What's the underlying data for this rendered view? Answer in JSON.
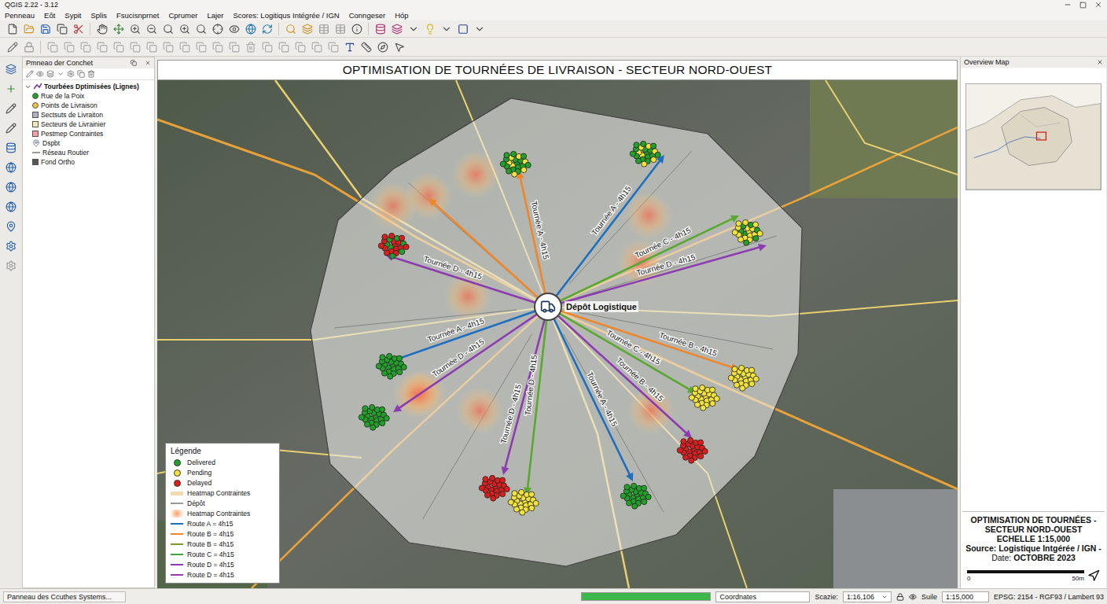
{
  "window": {
    "title": "QGIS 2.22 - 3.12"
  },
  "menu": [
    "Penneau",
    "Eôt",
    "Sypit",
    "Splis",
    "Fsucisnprnet",
    "Cprumer",
    "Lajer",
    "Scores: Logitiqus Intégrée / IGN",
    "Conngeser",
    "Hóp"
  ],
  "layers_panel": {
    "title": "Pmneao der Conchet",
    "layers": [
      {
        "label": "Tourbées Dptimisées (Lignes)",
        "kind": "group",
        "expanded": true,
        "color": "#6b3fa0"
      },
      {
        "label": "Rue de la Poix",
        "kind": "point",
        "color": "#22a02a"
      },
      {
        "label": "Points de Livraison",
        "kind": "point",
        "color": "#f2c43a"
      },
      {
        "label": "Sectsuts de Livraiton",
        "kind": "polygon",
        "color": "#a9b4c0"
      },
      {
        "label": "Secteurs de Livrainier",
        "kind": "polygon",
        "color": "#f3ecb0"
      },
      {
        "label": "Pestmep Contraintes",
        "kind": "heat",
        "color": "#f4a0a0"
      },
      {
        "label": "Dspbt",
        "kind": "pin",
        "color": "#5a6a80"
      },
      {
        "label": "Réseau Routier",
        "kind": "line",
        "color": "#9a9a9a"
      },
      {
        "label": "Fond Ortho",
        "kind": "raster",
        "color": "#555555"
      }
    ]
  },
  "map": {
    "title": "OPTIMISATION DE TOURNÉES DE LIVRAISON - SECTEUR NORD-OUEST",
    "depot": "Dépôt Logistique",
    "routes": [
      {
        "color": "#f0862a"
      },
      {
        "label": "Tournée A - 4h15",
        "color": "#f0862a"
      },
      {
        "label": "Tournée A - 4h15",
        "color": "#1f6fc0"
      },
      {
        "label": "Tournée C - 4h15",
        "color": "#5aa832"
      },
      {
        "label": "Tournée D - 4h15",
        "color": "#8c3cb0"
      },
      {
        "label": "Tournée D - 4h15",
        "color": "#8c3cb0"
      },
      {
        "label": "Tournée A - 4h15",
        "color": "#1f6fc0"
      },
      {
        "label": "Tournée D - 4h15",
        "color": "#8c3cb0"
      },
      {
        "label": "Tournée D - 4h15",
        "color": "#8c3cb0"
      },
      {
        "label": "Tournée D - 4h15",
        "color": "#5aa832"
      },
      {
        "label": "Tournée A - 4h15",
        "color": "#1f6fc0"
      },
      {
        "label": "Tournée B - 4h15",
        "color": "#8c3cb0"
      },
      {
        "label": "Tournée C - 4h15",
        "color": "#5aa832"
      },
      {
        "label": "Tournée B - 4h15",
        "color": "#f0862a"
      }
    ],
    "clusters": [
      {
        "color": "#22a02a",
        "secondary_color": "#f2e33a"
      },
      {
        "color": "#22a02a",
        "secondary_color": "#f2e33a"
      },
      {
        "color": "#d91e1e",
        "secondary_color": "#22a02a"
      },
      {
        "color": "#f2e33a",
        "secondary_color": "#22a02a"
      },
      {
        "color": "#22a02a"
      },
      {
        "color": "#22a02a"
      },
      {
        "color": "#f2e33a"
      },
      {
        "color": "#f2e33a"
      },
      {
        "color": "#d91e1e"
      },
      {
        "color": "#d91e1e"
      },
      {
        "color": "#f2e33a"
      },
      {
        "color": "#22a02a"
      }
    ],
    "legend": {
      "title": "Légende",
      "items": [
        {
          "label": "Delivered",
          "kind": "dot",
          "color": "#22a02a"
        },
        {
          "label": "Pending",
          "kind": "dot",
          "color": "#f2e33a"
        },
        {
          "label": "Delayed",
          "kind": "dot",
          "color": "#d91e1e"
        },
        {
          "label": "Heatmap Contraintes",
          "kind": "band",
          "color": "#f3d9b0"
        },
        {
          "label": "Dépôt",
          "kind": "line",
          "color": "#9a9a9a"
        },
        {
          "label": "Heatmap Contraintes",
          "kind": "heat",
          "color": "#f7a070"
        },
        {
          "label": "Route A = 4h15",
          "kind": "line",
          "color": "#1f6fc0"
        },
        {
          "label": "Route B = 4h15",
          "kind": "line",
          "color": "#f0862a"
        },
        {
          "label": "Route B = 4h15",
          "kind": "line",
          "color": "#7a9a2a"
        },
        {
          "label": "Route C = 4h15",
          "kind": "line",
          "color": "#3aa83a"
        },
        {
          "label": "Route D = 4h15",
          "kind": "line",
          "color": "#8c3cb0"
        },
        {
          "label": "Route D = 4h15",
          "kind": "line",
          "color": "#9a3cb0"
        }
      ]
    }
  },
  "overview": {
    "title": "Overview Map"
  },
  "title_block": {
    "lines": [
      "OPTIMISATION DE TOURNÉES -",
      "SECTEUR NORD-OUEST",
      "ECHELLE 1:15,000",
      "Source: Logistique Intgérée / IGN -"
    ],
    "date_label": "Date:",
    "date": "OCTOBRE 2023",
    "scale_start": "0",
    "scale_end": "50m"
  },
  "status_bar": {
    "message": "Panneau des Ccuthes Systems...",
    "progress": 1,
    "coordinates": "Coordnates",
    "scale_label": "Scazie:",
    "scale_value": "1:16,106",
    "scale2_label": "Suile",
    "scale2_value": "1:15,000",
    "crs": "EPSG: 2154 - RGF93 / Lambert 93"
  }
}
